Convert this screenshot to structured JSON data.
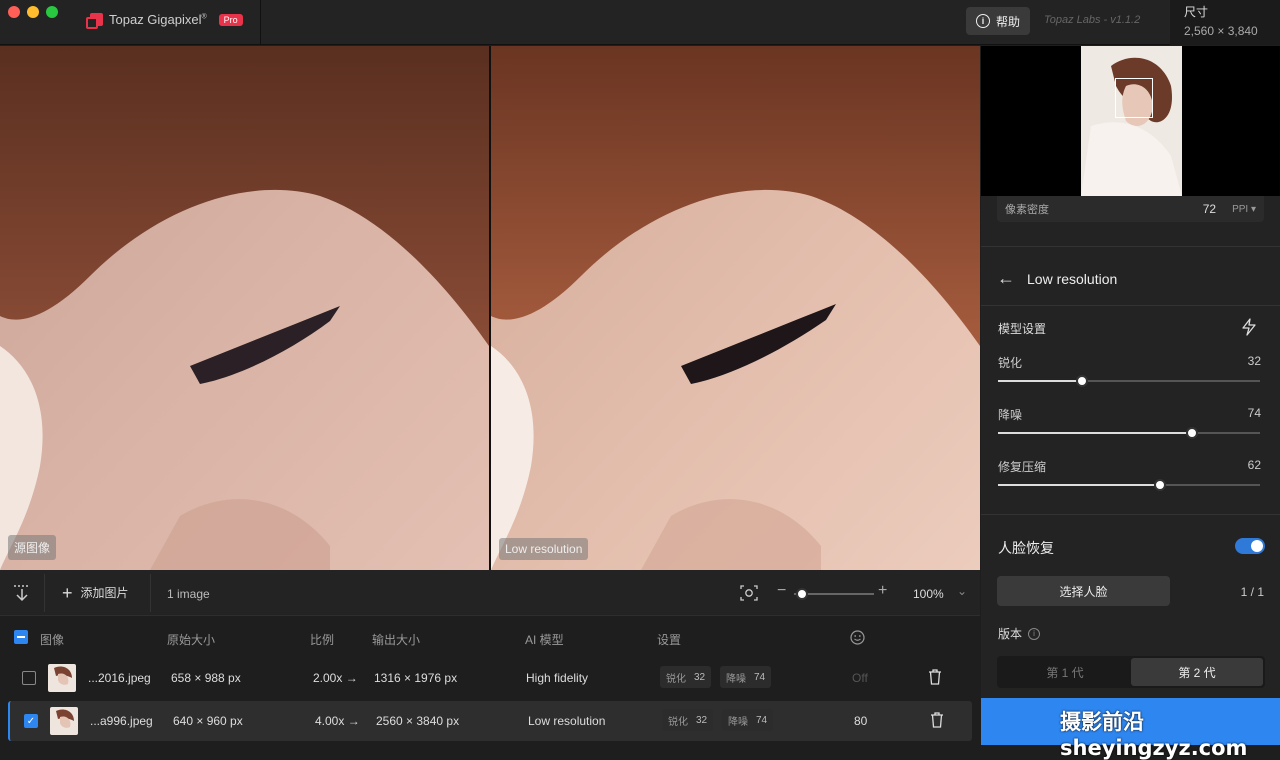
{
  "app": {
    "name": "Topaz Gigapixel",
    "tm": "®",
    "badge": "Pro",
    "help": "帮助",
    "version": "Topaz Labs - v1.1.2"
  },
  "dimensions": {
    "label": "尺寸",
    "value": "2,560 × 3,840"
  },
  "viewer": {
    "left_tag": "源图像",
    "right_tag": "Low resolution"
  },
  "panel": {
    "ppi_label": "像素密度",
    "ppi_value": "72",
    "ppi_unit": "PPI",
    "back_title": "Low resolution",
    "model_settings": "模型设置",
    "sliders": [
      {
        "label": "锐化",
        "value": "32",
        "fraction": 0.32
      },
      {
        "label": "降噪",
        "value": "74",
        "fraction": 0.74
      },
      {
        "label": "修复压缩",
        "value": "62",
        "fraction": 0.62
      }
    ],
    "face_label": "人脸恢复",
    "face_enabled": true,
    "select_face": "选择人脸",
    "face_count": "1 / 1",
    "version_label": "版本",
    "versions": [
      "第 1 代",
      "第 2 代"
    ],
    "active_version": 1
  },
  "toolbar": {
    "add_image": "添加图片",
    "image_count": "1 image",
    "zoom": "100%",
    "zoom_fraction": 0.1
  },
  "table": {
    "headers": {
      "image": "图像",
      "original": "原始大小",
      "scale": "比例",
      "output": "输出大小",
      "model": "AI 模型",
      "settings": "设置"
    },
    "rows": [
      {
        "name": "...2016.jpeg",
        "original": "658 × 988 px",
        "scale": "2.00x",
        "arrow": "→",
        "output": "1316 × 1976 px",
        "model": "High fidelity",
        "sharpen_label": "锐化",
        "sharpen": "32",
        "denoise_label": "降噪",
        "denoise": "74",
        "face": "Off",
        "selected": false
      },
      {
        "name": "...a996.jpeg",
        "original": "640 × 960 px",
        "scale": "4.00x",
        "arrow": "→",
        "output": "2560 × 3840 px",
        "model": "Low resolution",
        "sharpen_label": "锐化",
        "sharpen": "32",
        "denoise_label": "降噪",
        "denoise": "74",
        "face": "80",
        "selected": true
      }
    ]
  },
  "watermark": "摄影前沿 sheyingzyz.com",
  "colors": {
    "accent": "#2e86f0",
    "brand": "#e8334a",
    "panel_bg": "#232323"
  }
}
